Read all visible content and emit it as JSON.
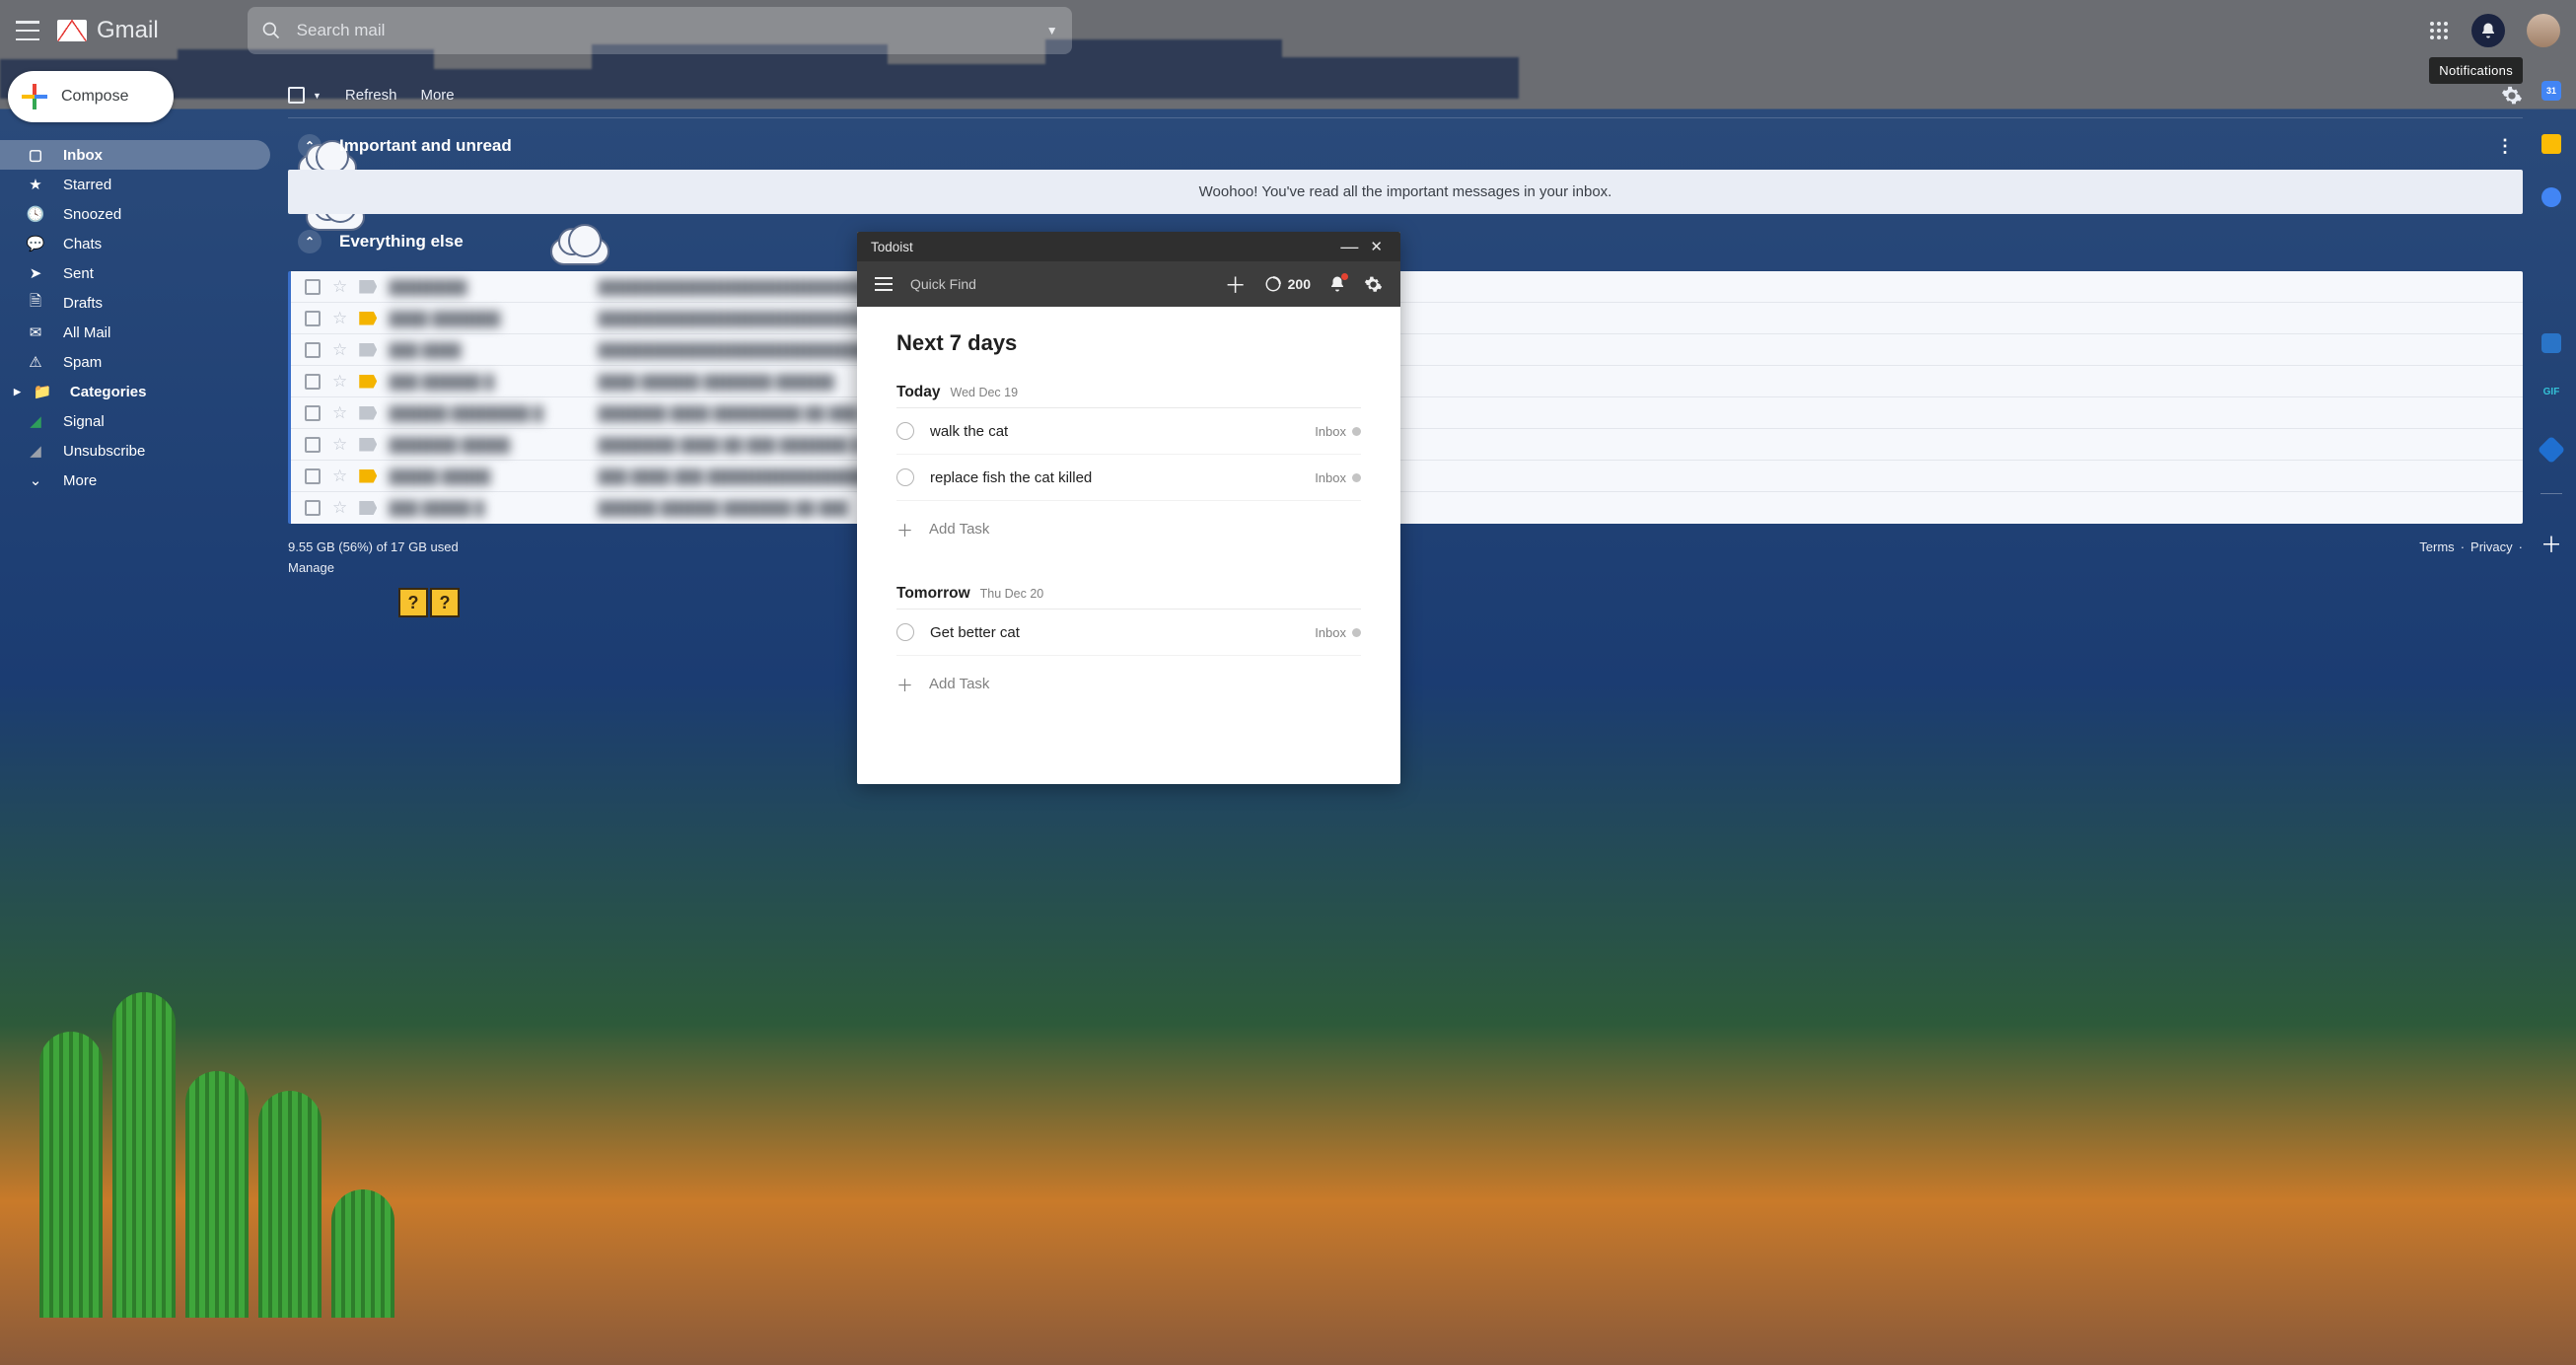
{
  "brand": "Gmail",
  "search": {
    "placeholder": "Search mail"
  },
  "tooltip": "Notifications",
  "compose_label": "Compose",
  "nav": {
    "inbox": "Inbox",
    "starred": "Starred",
    "snoozed": "Snoozed",
    "chats": "Chats",
    "sent": "Sent",
    "drafts": "Drafts",
    "allmail": "All Mail",
    "spam": "Spam",
    "categories": "Categories",
    "signal": "Signal",
    "unsubscribe": "Unsubscribe",
    "more": "More"
  },
  "toolbar": {
    "refresh": "Refresh",
    "more": "More"
  },
  "sections": {
    "important": "Important and unread",
    "everything": "Everything else"
  },
  "banner": "Woohoo! You've read all the important messages in your inbox.",
  "footer": {
    "storage": "9.55 GB (56%) of 17 GB used",
    "manage": "Manage",
    "terms": "Terms",
    "privacy": "Privacy"
  },
  "rightrail": {
    "gif_label": "GIF"
  },
  "todoist": {
    "title": "Todoist",
    "find_placeholder": "Quick Find",
    "karma": "200",
    "heading": "Next 7 days",
    "add_task": "Add Task",
    "days": [
      {
        "label": "Today",
        "date": "Wed Dec 19",
        "tasks": [
          {
            "text": "walk the cat",
            "project": "Inbox"
          },
          {
            "text": "replace fish the cat killed",
            "project": "Inbox"
          }
        ]
      },
      {
        "label": "Tomorrow",
        "date": "Thu Dec 20",
        "tasks": [
          {
            "text": "Get better cat",
            "project": "Inbox"
          }
        ]
      }
    ]
  }
}
